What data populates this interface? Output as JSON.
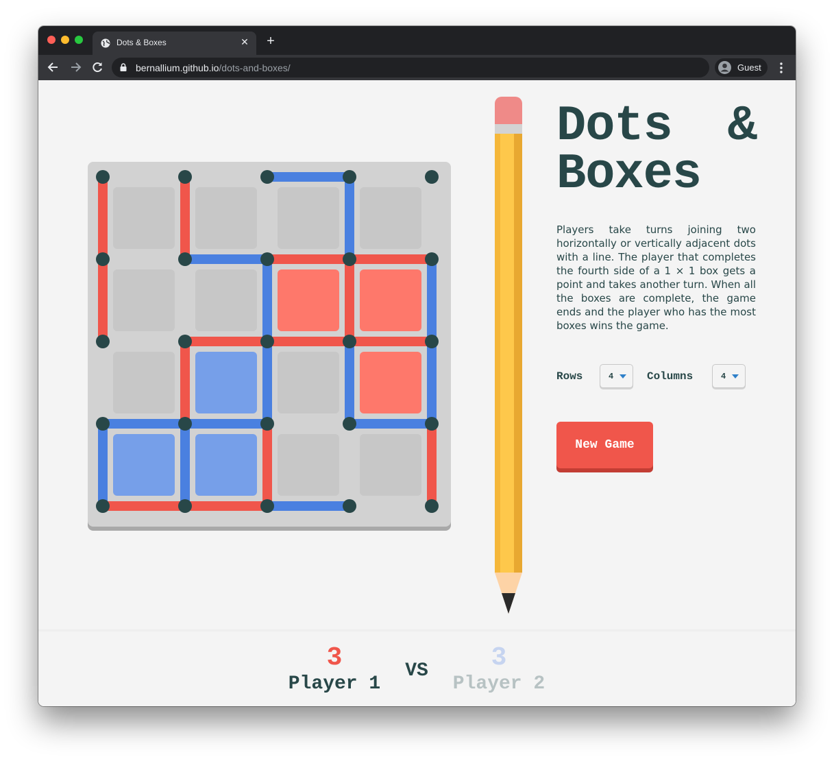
{
  "browser": {
    "tab_title": "Dots & Boxes",
    "url_host": "bernallium.github.io",
    "url_path": "/dots-and-boxes/",
    "profile_label": "Guest"
  },
  "game": {
    "title_word1": "Dots",
    "title_amp": "&",
    "title_word2": "Boxes",
    "description": "Players take turns joining two horizontally or vertically adjacent dots with a line. The player that completes the fourth side of a 1 × 1 box gets a point and takes another turn. When all the boxes are complete, the game ends and the player who has the most boxes wins the game.",
    "rows_label": "Rows",
    "rows_value": "4",
    "columns_label": "Columns",
    "columns_value": "4",
    "new_game_label": "New Game"
  },
  "colors": {
    "player1": "#f0564b",
    "player2": "#4a80e0",
    "box_player1": "#fe786b",
    "box_player2": "#769fe9",
    "box_empty": "#c7c7c7",
    "dot": "#284748"
  },
  "board": {
    "rows": 4,
    "columns": 4,
    "horizontal_lines": [
      [
        null,
        null,
        "p2",
        null
      ],
      [
        null,
        "p2",
        "p1",
        "p1"
      ],
      [
        null,
        "p1",
        "p1",
        "p1"
      ],
      [
        "p2",
        "p2",
        null,
        "p2"
      ],
      [
        "p1",
        "p1",
        "p2",
        null
      ]
    ],
    "vertical_lines": [
      [
        "p1",
        "p1",
        null,
        "p2"
      ],
      [
        "p1",
        null,
        "p2",
        "p1",
        "p2"
      ],
      [
        null,
        "p1",
        "p2",
        "p2",
        "p2"
      ],
      [
        "p2",
        "p2",
        "p1",
        null,
        "p1"
      ]
    ],
    "boxes": [
      [
        null,
        null,
        null,
        null
      ],
      [
        null,
        null,
        "p1",
        "p1"
      ],
      [
        null,
        "p2",
        null,
        "p1"
      ],
      [
        "p2",
        "p2",
        null,
        null
      ]
    ]
  },
  "score": {
    "player1_score": "3",
    "player1_name": "Player 1",
    "vs_label": "VS",
    "player2_score": "3",
    "player2_name": "Player 2"
  }
}
